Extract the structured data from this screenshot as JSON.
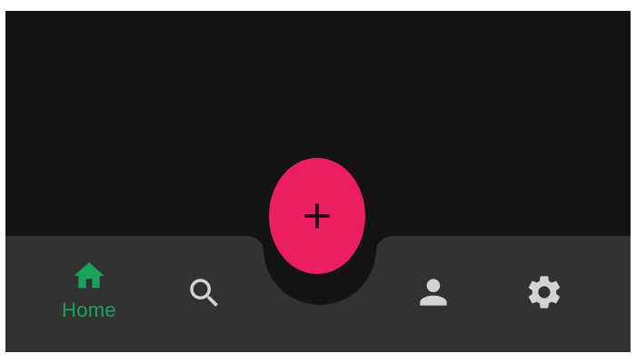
{
  "colors": {
    "screen_background": "#131313",
    "bar_background": "#323232",
    "active": "#1aa15a",
    "inactive": "#d3d3d3",
    "fab_background": "#ec1e62",
    "fab_icon": "#111111"
  },
  "fab": {
    "icon": "plus-icon"
  },
  "nav": {
    "items": [
      {
        "id": "home",
        "icon": "home-icon",
        "label": "Home",
        "active": true
      },
      {
        "id": "search",
        "icon": "search-icon",
        "label": "",
        "active": false
      },
      {
        "id": "profile",
        "icon": "person-icon",
        "label": "",
        "active": false
      },
      {
        "id": "settings",
        "icon": "gear-icon",
        "label": "",
        "active": false
      }
    ]
  }
}
